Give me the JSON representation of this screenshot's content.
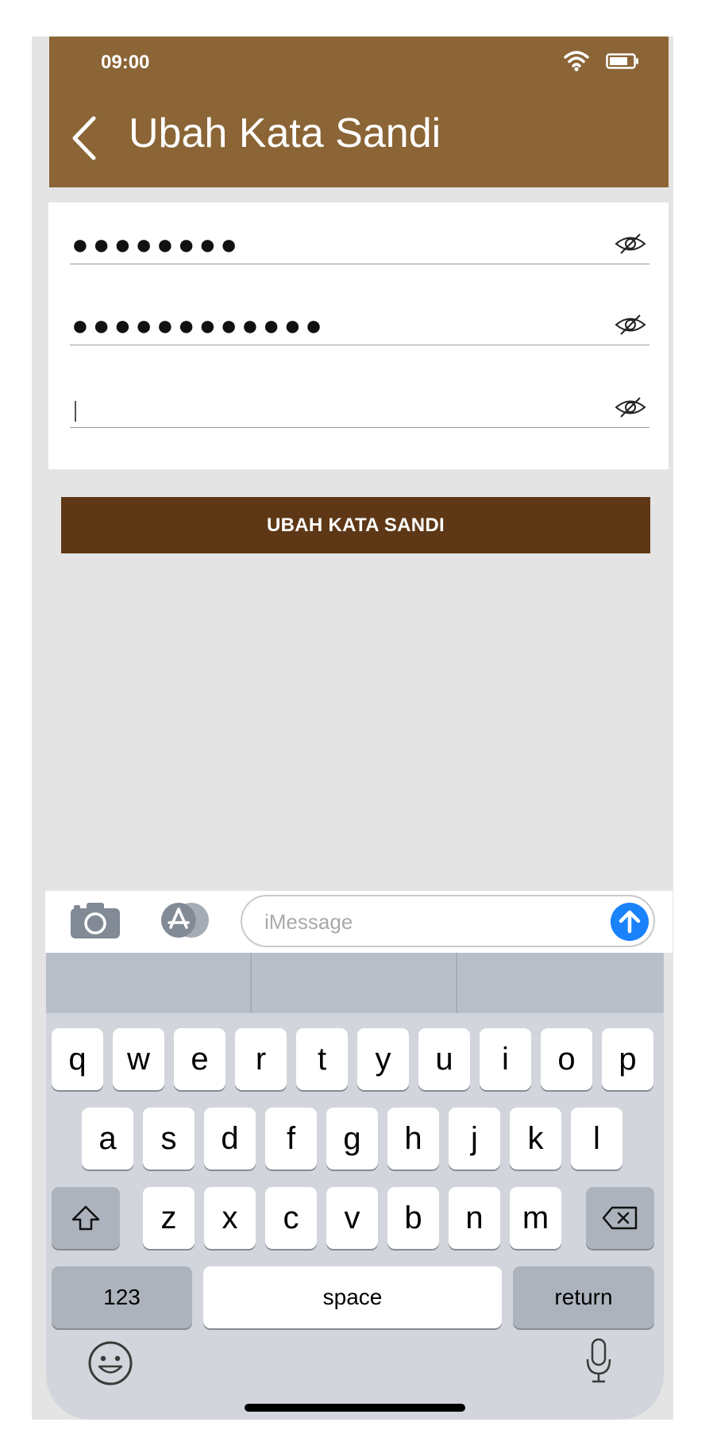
{
  "status_bar": {
    "time": "09:00"
  },
  "header": {
    "title": "Ubah Kata Sandi"
  },
  "form": {
    "fields": [
      {
        "masked_value": "●●●●●●●●"
      },
      {
        "masked_value": "●●●●●●●●●●●●"
      },
      {
        "masked_value": ""
      }
    ],
    "submit_label": "UBAH KATA SANDI"
  },
  "imessage": {
    "placeholder": "iMessage"
  },
  "keyboard": {
    "row1": [
      "q",
      "w",
      "e",
      "r",
      "t",
      "y",
      "u",
      "i",
      "o",
      "p"
    ],
    "row2": [
      "a",
      "s",
      "d",
      "f",
      "g",
      "h",
      "j",
      "k",
      "l"
    ],
    "row3": [
      "z",
      "x",
      "c",
      "v",
      "b",
      "n",
      "m"
    ],
    "numbers_label": "123",
    "space_label": "space",
    "return_label": "return"
  },
  "colors": {
    "header": "#8b6536",
    "button": "#5e3816",
    "send": "#1a82fb"
  }
}
